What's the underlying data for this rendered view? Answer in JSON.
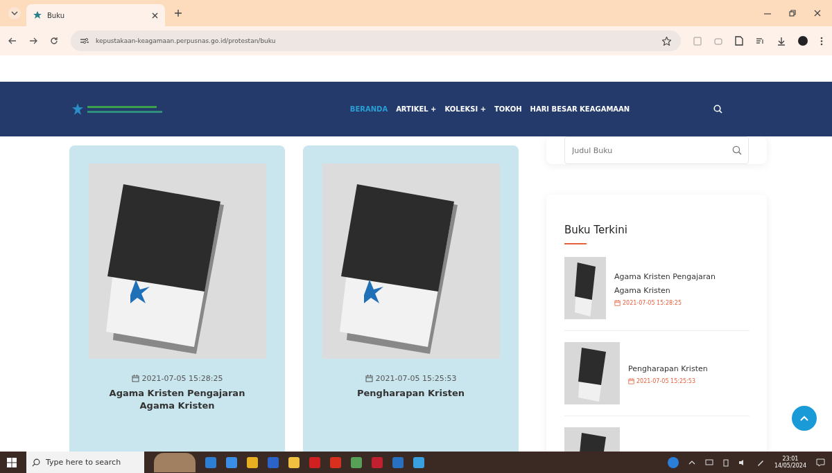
{
  "browser": {
    "tab": {
      "title": "Buku"
    },
    "url": "kepustakaan-keagamaan.perpusnas.go.id/protestan/buku"
  },
  "nav": {
    "items": [
      {
        "label": "BERANDA",
        "selected": true
      },
      {
        "label": "ARTIKEL +",
        "selected": false
      },
      {
        "label": "KOLEKSI +",
        "selected": false
      },
      {
        "label": "TOKOH",
        "selected": false
      },
      {
        "label": "HARI BESAR KEAGAMAAN",
        "selected": false
      }
    ]
  },
  "books": [
    {
      "date": "2021-07-05 15:28:25",
      "title": "Agama Kristen Pengajaran Agama Kristen"
    },
    {
      "date": "2021-07-05 15:25:53",
      "title": "Pengharapan Kristen"
    }
  ],
  "sidebar": {
    "search": {
      "placeholder": "Judul Buku"
    },
    "recent": {
      "heading": "Buku Terkini",
      "items": [
        {
          "title": "Agama Kristen Pengajaran Agama Kristen",
          "date": "2021-07-05 15:28:25"
        },
        {
          "title": "Pengharapan Kristen",
          "date": "2021-07-05 15:25:53"
        }
      ]
    }
  },
  "taskbar": {
    "search_placeholder": "Type here to search",
    "time": "23:01",
    "date": "14/05/2024"
  }
}
